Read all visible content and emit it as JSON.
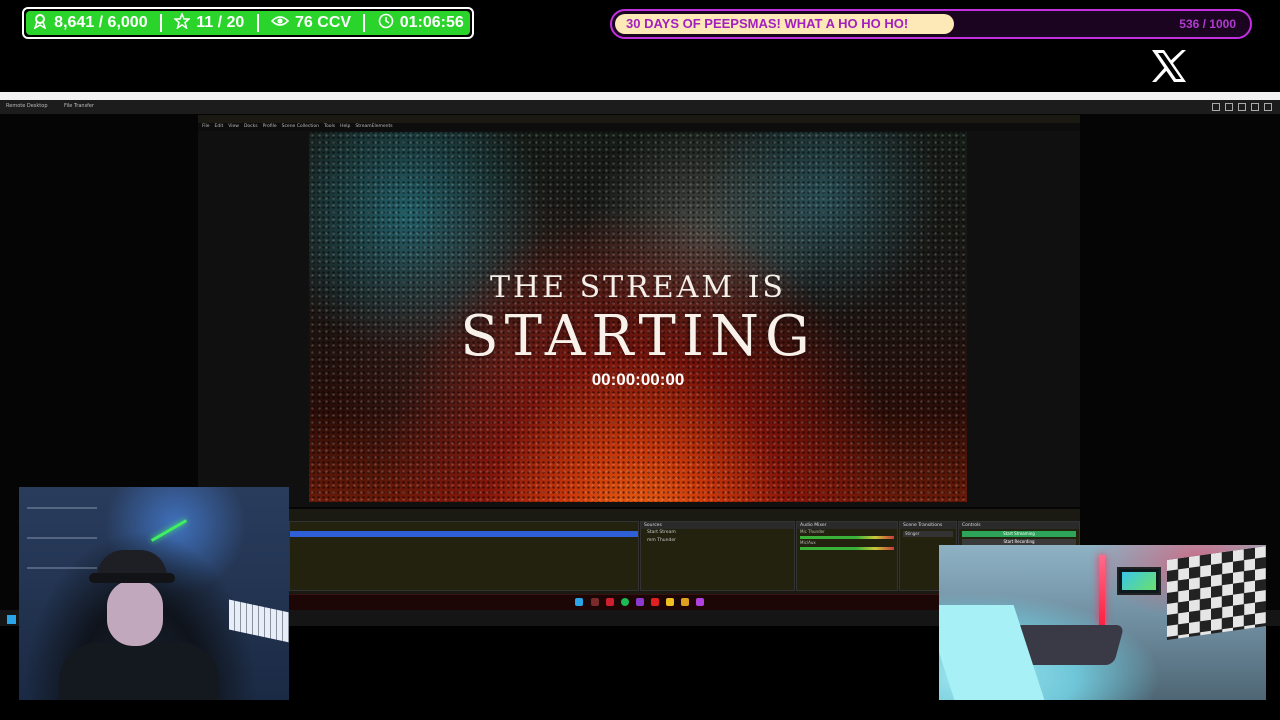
{
  "overlay": {
    "stats": [
      {
        "icon": "badge-icon",
        "value": "8,641 / 6,000"
      },
      {
        "icon": "star-icon",
        "value": "11 / 20"
      },
      {
        "icon": "eye-icon",
        "value": "76 CCV"
      },
      {
        "icon": "timer-icon",
        "value": "01:06:56"
      }
    ],
    "goal": {
      "title": "30 DAYS OF PEEPSMAS! WHAT A HO HO HO!",
      "count": "536 / 1000",
      "progress": 0.536
    },
    "social_icon": "x-logo-icon"
  },
  "obs": {
    "menu": [
      "File",
      "Edit",
      "View",
      "Docks",
      "Profile",
      "Scene Collection",
      "Tools",
      "Help",
      "StreamElements"
    ],
    "preview": {
      "line1": "THE STREAM IS",
      "line2": "STARTING",
      "timer": "00:00:00:00"
    },
    "docks": {
      "sources_title": "Sources",
      "sources": [
        "Start Stream",
        "mm Thunder"
      ],
      "mixer_title": "Audio Mixer",
      "mixer": [
        "Mic Thunder",
        "Mic/Aux"
      ],
      "transitions_title": "Scene Transitions",
      "transition": "Stinger",
      "controls_title": "Controls",
      "start_streaming": "Start Streaming",
      "start_recording": "Start Recording"
    }
  },
  "remote_desktop": {
    "tabs": [
      "Remote Desktop",
      "File Transfer"
    ]
  },
  "colors": {
    "stat_green": "#2bd42b",
    "goal_purple": "#c32fe0",
    "goal_fill": "#fde8b8"
  }
}
